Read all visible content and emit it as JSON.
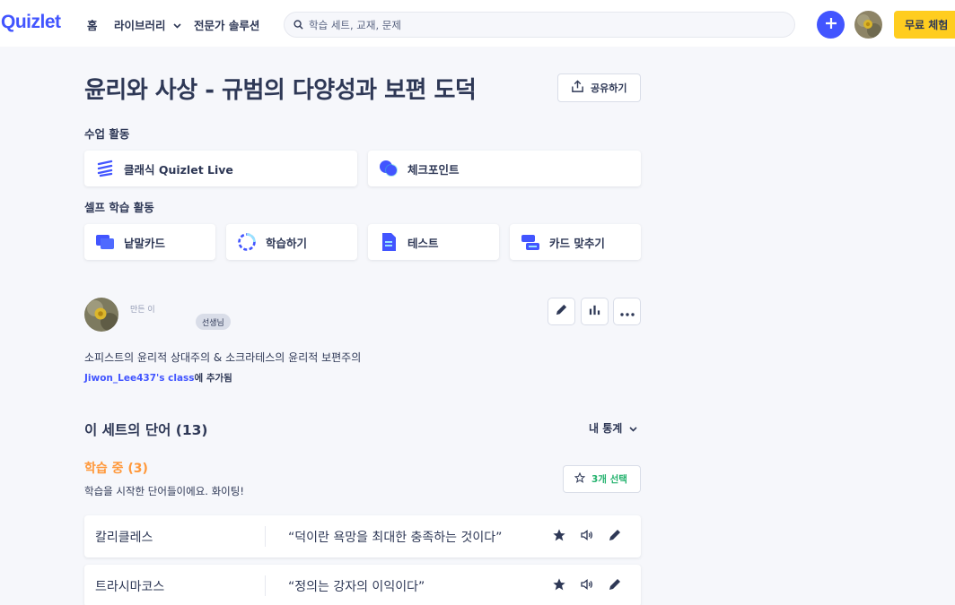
{
  "header": {
    "logo": "Quizlet",
    "nav": {
      "home": "홈",
      "library": "라이브러리",
      "expert": "전문가 솔루션"
    },
    "search_placeholder": "학습 세트, 교재, 문제",
    "trial_label": "무료 체험"
  },
  "set": {
    "title": "윤리와 사상 - 규범의 다양성과 보편 도덕",
    "share_label": "공유하기"
  },
  "class_activities": {
    "label": "수업 활동",
    "items": [
      {
        "label": "클래식 Quizlet Live",
        "icon": "live-icon"
      },
      {
        "label": "체크포인트",
        "icon": "checkpoint-icon"
      }
    ]
  },
  "self_activities": {
    "label": "셀프 학습 활동",
    "items": [
      {
        "label": "낱말카드",
        "icon": "flashcards-icon"
      },
      {
        "label": "학습하기",
        "icon": "learn-icon"
      },
      {
        "label": "테스트",
        "icon": "test-icon"
      },
      {
        "label": "카드 맞추기",
        "icon": "match-icon"
      }
    ]
  },
  "author": {
    "made_by": "만든 이",
    "badge": "선생님",
    "description": "소피스트의 윤리적 상대주의 & 소크라테스의 윤리적 보편주의",
    "class_name": "Jiwon_Lee437's class",
    "class_suffix": "에 추가됨"
  },
  "terms": {
    "title": "이 세트의 단어 (13)",
    "my_stats": "내 통계",
    "learning_heading": "학습 중 (3)",
    "learning_sub": "학습을 시작한 단어들이에요. 화이팅!",
    "select_label": "3개 선택",
    "rows": [
      {
        "term": "칼리클레스",
        "definition": "“덕이란 욕망을 최대한 충족하는 것이다”"
      },
      {
        "term": "트라시마코스",
        "definition": "“정의는 강자의 이익이다”"
      }
    ]
  },
  "colors": {
    "brand": "#4255ff",
    "trial": "#ffcd1f",
    "learning": "#ff983a",
    "select": "#23b26d",
    "text": "#2e3856"
  }
}
